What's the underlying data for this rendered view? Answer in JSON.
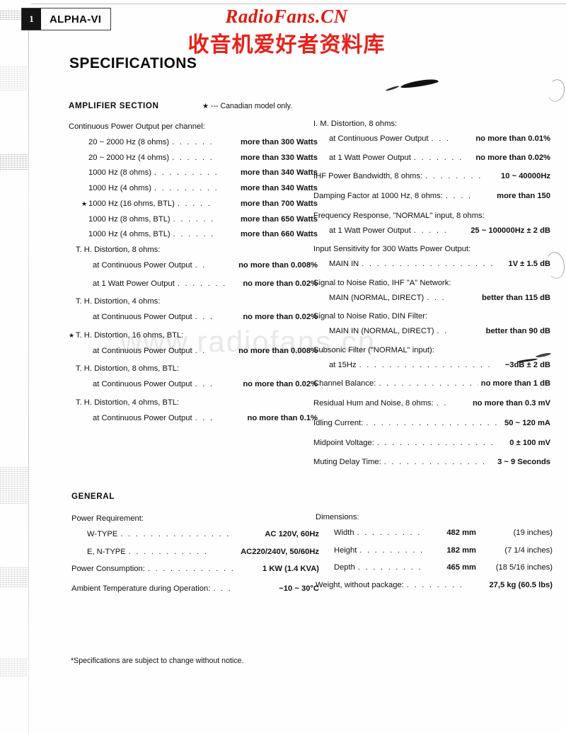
{
  "header": {
    "page_number": "1",
    "model": "ALPHA-VI",
    "watermark_brand": "RadioFans.CN",
    "watermark_brand_cn": "收音机爱好者资料库",
    "watermark_url": "www.radiofans.cn",
    "brand_color": "#e01b10",
    "title": "SPECIFICATIONS"
  },
  "amplifier": {
    "heading": "AMPLIFIER SECTION",
    "star_note": "--- Canadian model only.",
    "star_glyph": "★",
    "power_output": {
      "label": "Continuous Power Output per channel:",
      "rows": [
        {
          "star": false,
          "label": "20 ~ 2000 Hz (8 ohms)",
          "leader": ". . . . . .",
          "value": "more than 300 Watts"
        },
        {
          "star": false,
          "label": "20 ~ 2000 Hz (4 ohms)",
          "leader": ". . . . . .",
          "value": "more than 330 Watts"
        },
        {
          "star": false,
          "label": "1000 Hz (8 ohms)",
          "leader": ". . . . . . . . .",
          "value": "more than 340 Watts"
        },
        {
          "star": false,
          "label": "1000 Hz (4 ohms)",
          "leader": ". . . . . . . . .",
          "value": "more than 340 Watts"
        },
        {
          "star": true,
          "label": "1000 Hz (16 ohms, BTL)",
          "leader": ". . . . .",
          "value": "more than 700 Watts"
        },
        {
          "star": false,
          "label": "1000 Hz (8 ohms, BTL)",
          "leader": ". . . . . .",
          "value": "more than 650 Watts"
        },
        {
          "star": false,
          "label": "1000 Hz (4 ohms, BTL)",
          "leader": ". . . . . .",
          "value": "more than 660 Watts"
        }
      ]
    },
    "thd_groups": [
      {
        "star": false,
        "heading": "T. H. Distortion, 8 ohms:",
        "rows": [
          {
            "label": "at Continuous Power Output",
            "leader": ". .",
            "value": "no more than 0.008%"
          },
          {
            "label": "at 1 Watt Power Output",
            "leader": ". . . . . . .",
            "value": "no more than 0.02%"
          }
        ]
      },
      {
        "star": false,
        "heading": "T. H. Distortion, 4 ohms:",
        "rows": [
          {
            "label": "at Continuous Power Output",
            "leader": ". . .",
            "value": "no more than 0.02%"
          }
        ]
      },
      {
        "star": true,
        "heading": "T. H. Distortion, 16 ohms, BTL:",
        "rows": [
          {
            "label": "at Continuous Power Output",
            "leader": ". .",
            "value": "no more than 0.008%"
          }
        ]
      },
      {
        "star": false,
        "heading": "T. H. Distortion, 8 ohms, BTL:",
        "rows": [
          {
            "label": "at Continuous Power Output",
            "leader": ". . .",
            "value": "no more than 0.02%"
          }
        ]
      },
      {
        "star": false,
        "heading": "T. H. Distortion, 4 ohms, BTL:",
        "rows": [
          {
            "label": "at Continuous Power Output",
            "leader": ". . .",
            "value": "no more than 0.1%"
          }
        ]
      }
    ],
    "right_column": [
      {
        "heading": "I. M. Distortion, 8 ohms:",
        "rows": [
          {
            "label": "at Continuous Power Output",
            "leader": ". . .",
            "value": "no more than 0.01%"
          },
          {
            "label": "at 1 Watt Power Output",
            "leader": ". . . . . . .",
            "value": "no more than 0.02%"
          }
        ]
      },
      {
        "heading": "",
        "inline": {
          "label": "IHF Power Bandwidth, 8 ohms:",
          "leader": ". . . . . . . .",
          "value": "10 ~ 40000Hz"
        }
      },
      {
        "heading": "",
        "inline": {
          "label": "Damping Factor at 1000 Hz, 8 ohms:",
          "leader": ". . . .",
          "value": "more than 150"
        }
      },
      {
        "heading": "Frequency Response, \"NORMAL\" input, 8 ohms:",
        "rows": [
          {
            "label": "at 1 Watt Power Output",
            "leader": ". . . . .",
            "value": "25 ~ 100000Hz ± 2 dB"
          }
        ]
      },
      {
        "heading": "Input Sensitivity for 300 Watts Power Output:",
        "rows": [
          {
            "label": "MAIN  IN",
            "leader": ". . . . . . . . . . . . . . . . . .",
            "value": "1V ± 1.5 dB"
          }
        ]
      },
      {
        "heading": "Signal to Noise Ratio, IHF \"A\" Network:",
        "rows": [
          {
            "label": "MAIN  (NORMAL, DIRECT)",
            "leader": ". . .",
            "value": "better than 115 dB"
          }
        ]
      },
      {
        "heading": "Signal to Noise Ratio, DIN Filter:",
        "rows": [
          {
            "label": "MAIN IN (NORMAL, DIRECT)",
            "leader": ". .",
            "value": "better than 90 dB"
          }
        ]
      },
      {
        "heading": "Subsonic Filter (\"NORMAL\" input):",
        "rows": [
          {
            "label": "at 15Hz",
            "leader": ". . . . . . . . . . . . . . . . . .",
            "value": "−3dB ± 2 dB"
          }
        ]
      },
      {
        "heading": "",
        "inline": {
          "label": "Channel Balance:",
          "leader": ". . . . . . . . . . . . . .",
          "value": "no more than 1 dB"
        }
      },
      {
        "heading": "",
        "inline": {
          "label": "Residual Hum and Noise, 8 ohms:",
          "leader": ". .",
          "value": "no more than 0.3 mV"
        }
      },
      {
        "heading": "",
        "inline": {
          "label": "Idling Current:",
          "leader": ". . . . . . . . . . . . . . . . . .",
          "value": "50 ~ 120 mA"
        }
      },
      {
        "heading": "",
        "inline": {
          "label": "Midpoint Voltage:",
          "leader": ". . . . . . . . . . . . . . . .",
          "value": "0 ± 100 mV"
        }
      },
      {
        "heading": "",
        "inline": {
          "label": "Muting Delay Time:",
          "leader": ". . . . . . . . . . . . . .",
          "value": "3 ~ 9 Seconds"
        }
      }
    ]
  },
  "general": {
    "heading": "GENERAL",
    "power_requirement": {
      "label": "Power Requirement:",
      "rows": [
        {
          "label": "W-TYPE",
          "leader": ". . . . . . . . . . . . . . .",
          "value": "AC 120V,  60Hz"
        },
        {
          "label": "E,  N-TYPE",
          "leader": ". . . . . . . . . . .",
          "value": "AC220/240V,  50/60Hz"
        }
      ]
    },
    "power_consumption": {
      "label": "Power Consumption:",
      "leader": ". . . . . . . . . . . .",
      "value": "1 KW (1.4 KVA)"
    },
    "ambient_temperature": {
      "label": "Ambient Temperature during Operation:",
      "leader": ". . .",
      "value": "−10 ~ 30°C"
    },
    "dimensions": {
      "label": "Dimensions:",
      "rows": [
        {
          "label": "Width",
          "leader": ". . . . . . . . . . . . .",
          "value": "482 mm",
          "inches": "(19 inches)"
        },
        {
          "label": "Height",
          "leader": ". . . . . . . . . . . . .",
          "value": "182 mm",
          "inches": "(7 1/4 inches)"
        },
        {
          "label": "Depth",
          "leader": ". . . . . . . . . . . . . .",
          "value": "465 mm",
          "inches": "(18 5/16 inches)"
        }
      ]
    },
    "weight": {
      "label": "Weight, without package:",
      "leader": ". . . . . . . .",
      "value": "27,5 kg  (60.5  lbs)"
    }
  },
  "footnote": "*Specifications are subject to change without notice."
}
